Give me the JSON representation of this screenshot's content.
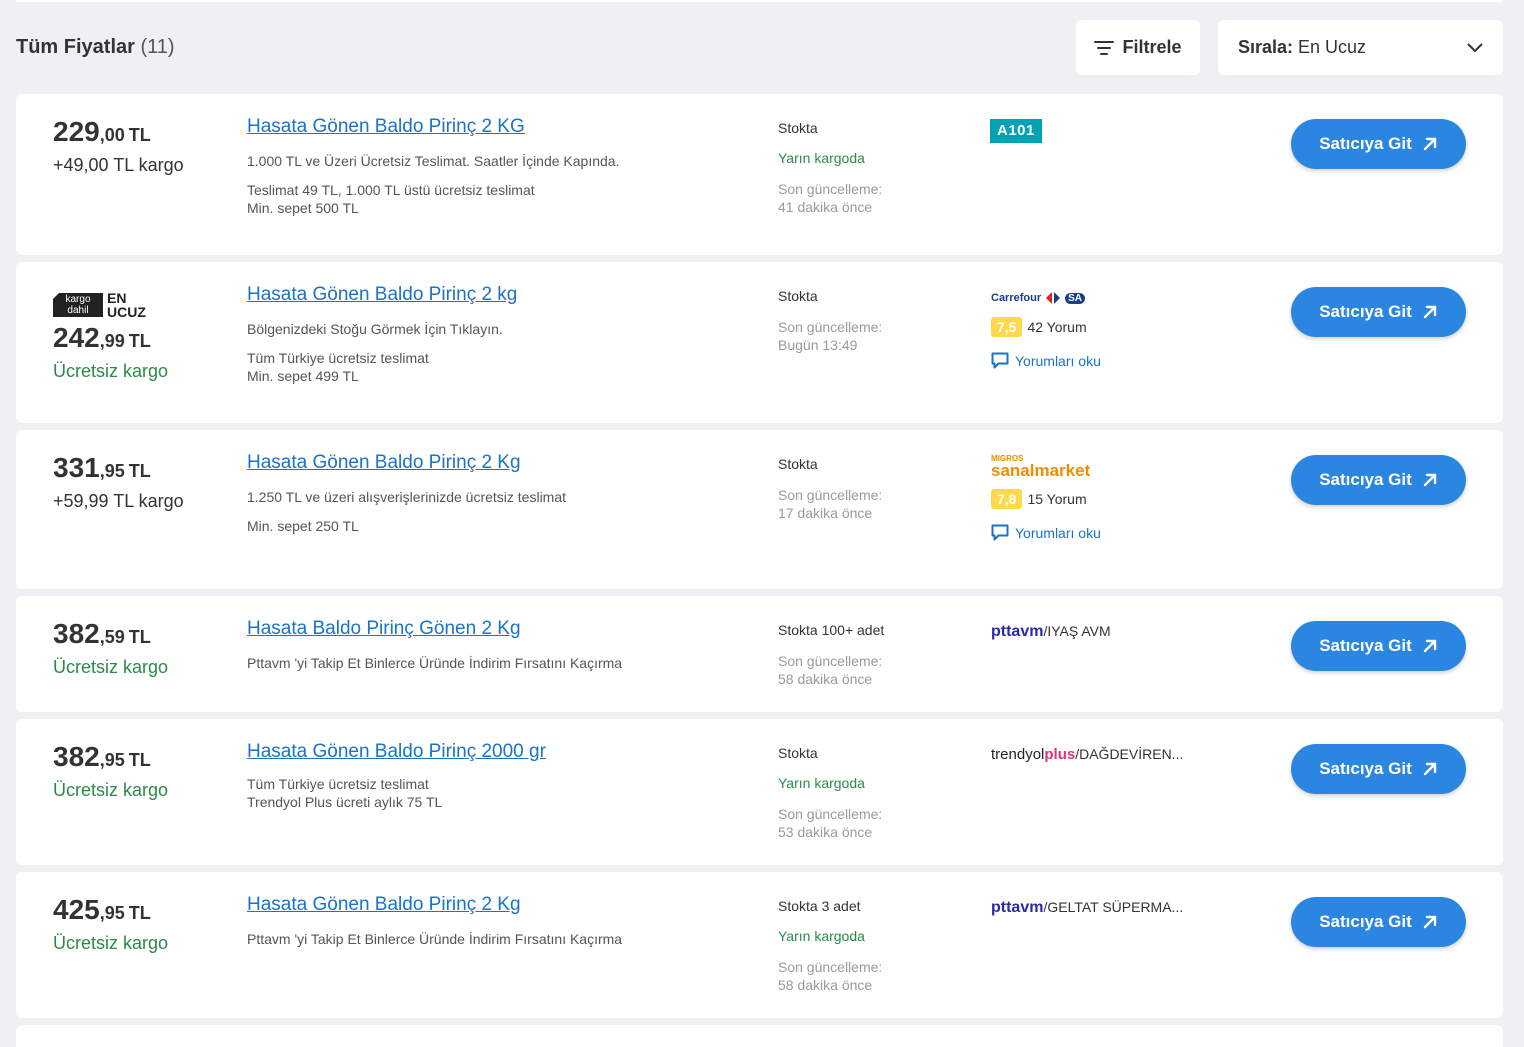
{
  "header": {
    "title": "Tüm Fiyatlar",
    "count": "(11)",
    "filter_label": "Filtrele",
    "sort_label": "Sırala:",
    "sort_value": "En Ucuz"
  },
  "colors": {
    "primary_button": "#2a86e0",
    "link": "#1a73c8",
    "free_shipping": "#2b8a4b",
    "rating_badge": "#ffd84d"
  },
  "button_label": "Satıcıya Git",
  "review_link_label": "Yorumları oku",
  "offers": [
    {
      "price_int": "229",
      "price_dec": ",00",
      "currency": "TL",
      "shipping": "+49,00 TL kargo",
      "title": "Hasata Gönen Baldo Pirinç 2 KG",
      "desc": "1.000 TL ve Üzeri Ücretsiz Teslimat. Saatler İçinde Kapında.",
      "desc2a": "Teslimat 49 TL, 1.000 TL üstü ücretsiz teslimat",
      "desc2b": "Min. sepet 500 TL",
      "stock": "Stokta",
      "cargo_day": "Yarın kargoda",
      "updated_label": "Son güncelleme:",
      "updated_value": "41 dakika önce",
      "seller_logo": "A101"
    },
    {
      "badge_box": "kargo dahil",
      "badge_text_1": "EN",
      "badge_text_2": "UCUZ",
      "price_int": "242",
      "price_dec": ",99",
      "currency": "TL",
      "shipping": "Ücretsiz kargo",
      "title": "Hasata Gönen Baldo Pirinç 2 kg",
      "desc": "Bölgenizdeki Stoğu Görmek İçin Tıklayın.",
      "desc2a": "Tüm Türkiye ücretsiz teslimat",
      "desc2b": "Min. sepet 499 TL",
      "stock": "Stokta",
      "updated_label": "Son güncelleme:",
      "updated_value": "Bugün 13:49",
      "seller_logo": "Carrefour",
      "seller_logo_sub": "SA",
      "rating": "7,5",
      "reviews": "42 Yorum"
    },
    {
      "price_int": "331",
      "price_dec": ",95",
      "currency": "TL",
      "shipping": "+59,99 TL kargo",
      "title": "Hasata Gönen Baldo Pirinç 2 Kg",
      "desc": "1.250 TL ve üzeri alışverişlerinizde ücretsiz teslimat",
      "desc2a": "Min. sepet 250 TL",
      "stock": "Stokta",
      "updated_label": "Son güncelleme:",
      "updated_value": "17 dakika önce",
      "seller_logo_small": "MIGROS",
      "seller_logo_big": "sanalmarket",
      "rating": "7,8",
      "reviews": "15 Yorum"
    },
    {
      "price_int": "382",
      "price_dec": ",59",
      "currency": "TL",
      "shipping": "Ücretsiz kargo",
      "title": "Hasata Baldo Pirinç Gönen 2 Kg",
      "desc": "Pttavm 'yi Takip Et Binlerce Üründe İndirim Fırsatını Kaçırma",
      "stock": "Stokta 100+ adet",
      "updated_label": "Son güncelleme:",
      "updated_value": "58 dakika önce",
      "seller_logo": "pttavm",
      "seller_name": "/IYAŞ AVM"
    },
    {
      "price_int": "382",
      "price_dec": ",95",
      "currency": "TL",
      "shipping": "Ücretsiz kargo",
      "title": "Hasata Gönen Baldo Pirinç 2000 gr",
      "desc2a": "Tüm Türkiye ücretsiz teslimat",
      "desc2b": "Trendyol Plus ücreti aylık 75 TL",
      "stock": "Stokta",
      "cargo_day": "Yarın kargoda",
      "updated_label": "Son güncelleme:",
      "updated_value": "53 dakika önce",
      "seller_logo": "trendyol",
      "seller_logo_plus": "plus",
      "seller_name": "/DAĞDEVİREN..."
    },
    {
      "price_int": "425",
      "price_dec": ",95",
      "currency": "TL",
      "shipping": "Ücretsiz kargo",
      "title": "Hasata Gönen Baldo Pirinç 2 Kg",
      "desc": "Pttavm 'yi Takip Et Binlerce Üründe İndirim Fırsatını Kaçırma",
      "stock": "Stokta 3 adet",
      "cargo_day": "Yarın kargoda",
      "updated_label": "Son güncelleme:",
      "updated_value": "58 dakika önce",
      "seller_logo": "pttavm",
      "seller_name": "/GELTAT SÜPERMA..."
    }
  ]
}
